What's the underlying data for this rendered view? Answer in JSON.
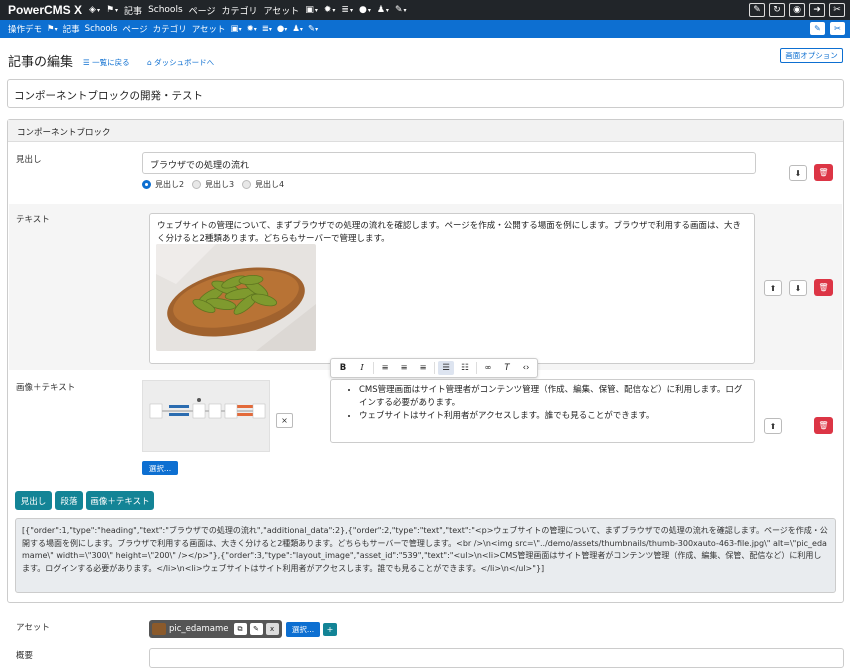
{
  "topbar": {
    "brand": "PowerCMS X",
    "entry": "記事",
    "schools": "Schools",
    "page": "ページ",
    "category": "カテゴリ",
    "asset": "アセット"
  },
  "bluebar": {
    "demo": "操作デモ",
    "entry": "記事",
    "schools": "Schools",
    "page": "ページ",
    "category": "カテゴリ",
    "asset": "アセット"
  },
  "header": {
    "title": "記事の編集",
    "back_link": "一覧に戻る",
    "dashboard_link": "ダッシュボードへ",
    "screen_options": "画面オプション"
  },
  "entry": {
    "title": "コンポーネントブロックの開発・テスト"
  },
  "component_block": {
    "heading": "コンポーネントブロック",
    "rows": {
      "heading_label": "見出し",
      "heading_value": "ブラウザでの処理の流れ",
      "radio": [
        "見出し2",
        "見出し3",
        "見出し4"
      ],
      "text_label": "テキスト",
      "text_value": "ウェブサイトの管理について、まずブラウザでの処理の流れを確認します。ページを作成・公開する場面を例にします。ブラウザで利用する画面は、大きく分けると2種類あります。どちらもサーバーで管理します。",
      "image_text_label": "画像＋テキスト",
      "select_button": "選択...",
      "list_items": [
        "CMS管理画面はサイト管理者がコンテンツ管理（作成、編集、保管、配信など）に利用します。ログインする必要があります。",
        "ウェブサイトはサイト利用者がアクセスします。誰でも見ることができます。"
      ]
    },
    "add_buttons": [
      "見出し",
      "段落",
      "画像＋テキスト"
    ],
    "json_value": "[{\"order\":1,\"type\":\"heading\",\"text\":\"ブラウザでの処理の流れ\",\"additional_data\":2},{\"order\":2,\"type\":\"text\",\"text\":\"<p>ウェブサイトの管理について、まずブラウザでの処理の流れを確認します。ページを作成・公開する場面を例にします。ブラウザで利用する画面は、大きく分けると2種類あります。どちらもサーバーで管理します。<br />\\n<img src=\\\"../demo/assets/thumbnails/thumb-300xauto-463-file.jpg\\\" alt=\\\"pic_edamame\\\" width=\\\"300\\\" height=\\\"200\\\" /></p>\"},{\"order\":3,\"type\":\"layout_image\",\"asset_id\":\"539\",\"text\":\"<ul>\\n<li>CMS管理画面はサイト管理者がコンテンツ管理（作成、編集、保管、配信など）に利用します。ログインする必要があります。</li>\\n<li>ウェブサイトはサイト利用者がアクセスします。誰でも見ることができます。</li>\\n</ul>\"}]"
  },
  "asset": {
    "label": "アセット",
    "name": "pic_edamame",
    "select_button": "選択...",
    "remove": "x"
  },
  "summary": {
    "label": "概要"
  },
  "colors": {
    "topbar": "#212529",
    "accent": "#0d6fd1",
    "danger": "#dc3545",
    "teal": "#138496"
  }
}
